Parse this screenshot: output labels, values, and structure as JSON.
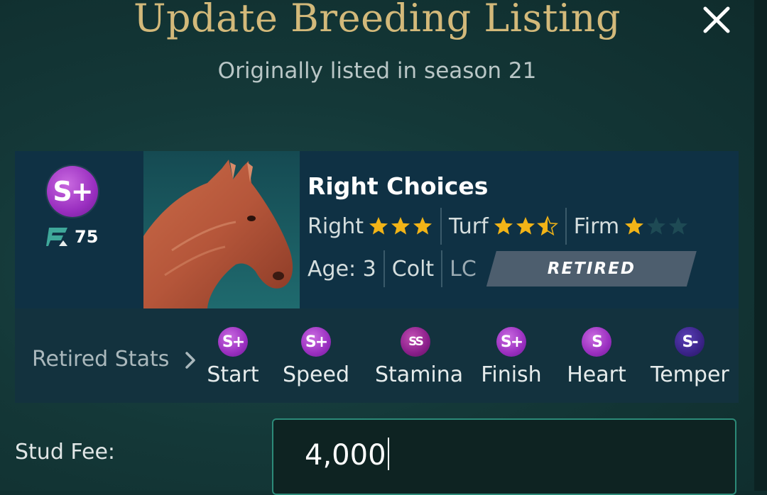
{
  "dialog": {
    "title": "Update Breeding Listing",
    "subtitle": "Originally listed in season 21",
    "close_icon": "close-icon"
  },
  "horse": {
    "grade": "S+",
    "rating": "75",
    "name": "Right Choices",
    "direction": {
      "label": "Right",
      "stars": 3
    },
    "surface": {
      "label": "Turf",
      "stars": 2.5
    },
    "condition": {
      "label": "Firm",
      "stars": 1
    },
    "age": "Age: 3",
    "sex": "Colt",
    "region": "LC",
    "status": "RETIRED"
  },
  "retired_stats": {
    "label": "Retired Stats",
    "items": [
      {
        "name": "Start",
        "grade": "S+"
      },
      {
        "name": "Speed",
        "grade": "S+"
      },
      {
        "name": "Stamina",
        "grade": "SS"
      },
      {
        "name": "Finish",
        "grade": "S+"
      },
      {
        "name": "Heart",
        "grade": "S"
      },
      {
        "name": "Temper",
        "grade": "S-"
      }
    ]
  },
  "stud_fee": {
    "label": "Stud Fee:",
    "value": "4,000"
  },
  "colors": {
    "title_gold": "#d3b97a",
    "star_gold": "#f2b417",
    "star_empty": "#1e4a54",
    "badge_purple": "#9a2fc0",
    "input_border": "#2c8a78"
  }
}
